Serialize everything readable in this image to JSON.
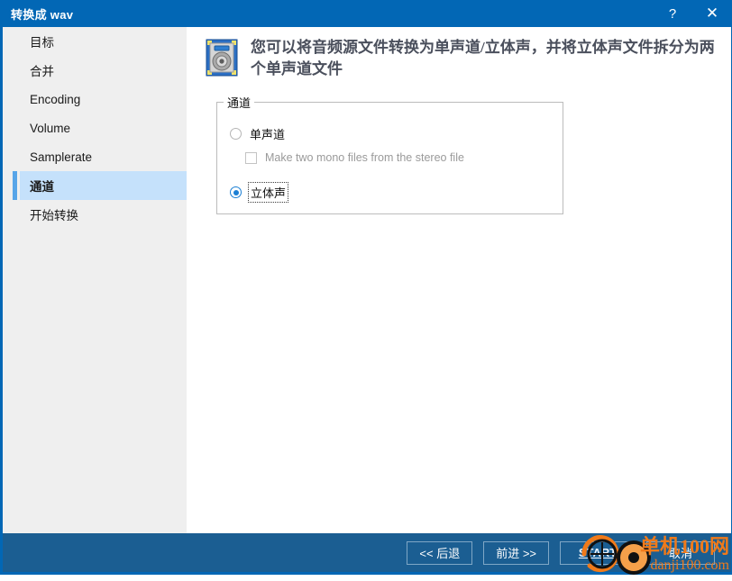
{
  "window": {
    "title": "转换成 wav",
    "help_label": "?",
    "close_label": "✕",
    "accent_color": "#0267b5",
    "bottom_bar_color": "#1b5e92"
  },
  "sidebar": {
    "items": [
      {
        "label": "目标",
        "selected": false
      },
      {
        "label": "合并",
        "selected": false
      },
      {
        "label": "Encoding",
        "selected": false
      },
      {
        "label": "Volume",
        "selected": false
      },
      {
        "label": "Samplerate",
        "selected": false
      },
      {
        "label": "通道",
        "selected": true
      },
      {
        "label": "开始转换",
        "selected": false
      }
    ],
    "selected_highlight_color": "#c5e1fb",
    "selected_accent_color": "#58a5e8"
  },
  "main": {
    "header_icon": "audio-device-icon",
    "header_text": "您可以将音频源文件转换为单声道/立体声，并将立体声文件拆分为两个单声道文件",
    "group": {
      "legend": "通道",
      "options": [
        {
          "type": "radio",
          "label": "单声道",
          "checked": false,
          "disabled": false
        },
        {
          "type": "checkbox",
          "label": "Make two mono files from the stereo file",
          "checked": false,
          "disabled": true
        },
        {
          "type": "radio",
          "label": "立体声",
          "checked": true,
          "disabled": false,
          "focused": true
        }
      ]
    }
  },
  "actions": {
    "back_label": "<< 后退",
    "next_label": "前进 >>",
    "start_label": "START",
    "cancel_label": "取消"
  },
  "watermark": {
    "line1": "单机100网",
    "line2": "danji100.com",
    "color": "#f07a1a"
  }
}
